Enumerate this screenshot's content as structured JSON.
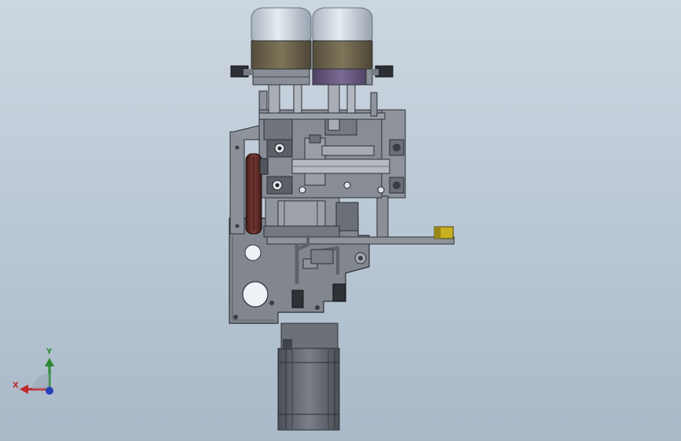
{
  "viewport": {
    "background_top": "#ccd6e0",
    "background_bottom": "#a9b9c8"
  },
  "model": {
    "description_icon": "cad-assembly",
    "colors": {
      "frame": "#7d828c",
      "frame_dark": "#4a4e57",
      "cup": "#c9d2dc",
      "cup_band_left": "#6e6650",
      "cup_band_right": "#6a5a7e",
      "pulley": "#6a2f2c",
      "yellow_sensor": "#c8b020",
      "motor": "#5f646d"
    }
  },
  "triad": {
    "x_label": "X",
    "y_label": "Y",
    "x_color": "#c0262b",
    "y_color": "#2a8a2f",
    "z_color": "#2540b8"
  }
}
